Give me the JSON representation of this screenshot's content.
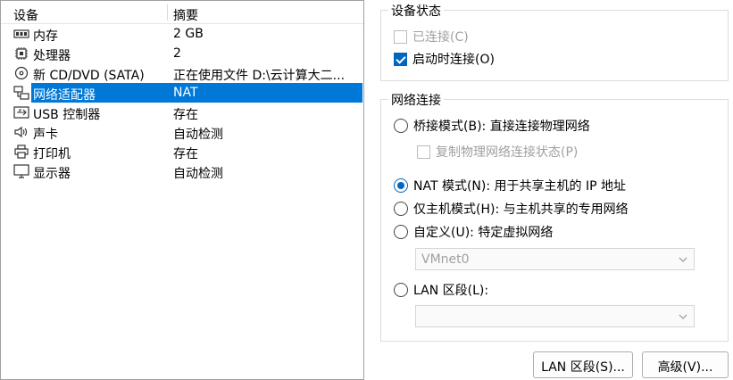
{
  "device_list": {
    "header_device": "设备",
    "header_summary": "摘要",
    "rows": [
      {
        "name": "内存",
        "summary": "2 GB",
        "icon": "memory-icon"
      },
      {
        "name": "处理器",
        "summary": "2",
        "icon": "processor-icon"
      },
      {
        "name": "新 CD/DVD (SATA)",
        "summary": "正在使用文件 D:\\云计算大二...",
        "icon": "disc-icon"
      },
      {
        "name": "网络适配器",
        "summary": "NAT",
        "icon": "network-adapter-icon"
      },
      {
        "name": "USB 控制器",
        "summary": "存在",
        "icon": "usb-icon"
      },
      {
        "name": "声卡",
        "summary": "自动检测",
        "icon": "speaker-icon"
      },
      {
        "name": "打印机",
        "summary": "存在",
        "icon": "printer-icon"
      },
      {
        "name": "显示器",
        "summary": "自动检测",
        "icon": "monitor-icon"
      }
    ]
  },
  "device_status": {
    "title": "设备状态",
    "connected": "已连接(C)",
    "connect_at_power_on": "启动时连接(O)"
  },
  "network_connection": {
    "title": "网络连接",
    "bridged": "桥接模式(B): 直接连接物理网络",
    "replicate": "复制物理网络连接状态(P)",
    "nat": "NAT 模式(N): 用于共享主机的 IP 地址",
    "host_only": "仅主机模式(H): 与主机共享的专用网络",
    "custom": "自定义(U): 特定虚拟网络",
    "custom_select_value": "VMnet0",
    "lan_segment": "LAN 区段(L):",
    "lan_select_value": ""
  },
  "buttons": {
    "lan_segments": "LAN 区段(S)...",
    "advanced": "高级(V)..."
  },
  "colors": {
    "selection": "#0078d7",
    "accent": "#0067c0"
  }
}
